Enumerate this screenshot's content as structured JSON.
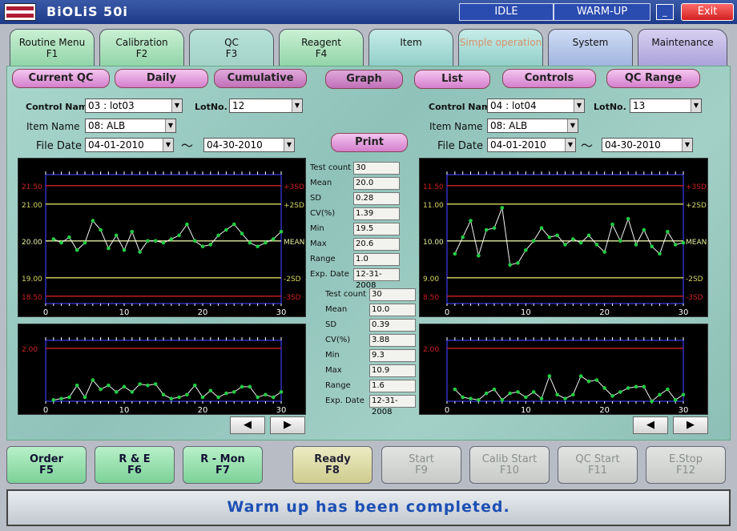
{
  "app": {
    "title": "BiOLiS  50i",
    "status_idle": "IDLE",
    "status_warmup": "WARM-UP",
    "minimize": "_",
    "exit": "Exit"
  },
  "tabs": [
    {
      "label": "Routine Menu",
      "key": "F1"
    },
    {
      "label": "Calibration",
      "key": "F2"
    },
    {
      "label": "QC",
      "key": "F3"
    },
    {
      "label": "Reagent",
      "key": "F4"
    },
    {
      "label": "Item",
      "key": ""
    },
    {
      "label": "Simple operation",
      "key": ""
    },
    {
      "label": "System",
      "key": ""
    },
    {
      "label": "Maintenance",
      "key": ""
    }
  ],
  "subnav": {
    "current_qc": "Current QC",
    "daily": "Daily",
    "cumulative": "Cumulative",
    "graph": "Graph",
    "list": "List",
    "controls": "Controls",
    "qc_range": "QC Range",
    "print": "Print"
  },
  "left": {
    "control_name_label": "Control Name",
    "control_name": "03 : lot03",
    "lotno_label": "LotNo.",
    "lotno": "12",
    "item_name_label": "Item Name",
    "item_name": "08: ALB",
    "file_date_label": "File Date",
    "date_from": "04-01-2010",
    "tilde": "〜",
    "date_to": "04-30-2010",
    "stats_labels": [
      "Test count",
      "Mean",
      "SD",
      "CV(%)",
      "Min",
      "Max",
      "Range",
      "Exp. Date"
    ],
    "stats_values": [
      "30",
      "20.0",
      "0.28",
      "1.39",
      "19.5",
      "20.6",
      "1.0",
      "12-31-2008"
    ]
  },
  "right": {
    "control_name_label": "Control Name",
    "control_name": "04 : lot04",
    "lotno_label": "LotNo.",
    "lotno": "13",
    "item_name_label": "Item Name",
    "item_name": "08: ALB",
    "file_date_label": "File Date",
    "date_from": "04-01-2010",
    "tilde": "〜",
    "date_to": "04-30-2010",
    "stats_labels": [
      "Test count",
      "Mean",
      "SD",
      "CV(%)",
      "Min",
      "Max",
      "Range",
      "Exp. Date"
    ],
    "stats_values": [
      "30",
      "10.0",
      "0.39",
      "3.88",
      "9.3",
      "10.9",
      "1.6",
      "12-31-2008"
    ]
  },
  "chart_data": [
    {
      "type": "line",
      "name": "left-levey-jennings",
      "ylim": [
        18.3,
        21.8
      ],
      "yticks": [
        "21.50",
        "21.00",
        "20.00",
        "19.00",
        "18.50"
      ],
      "ytick_values": [
        21.5,
        21.0,
        20.0,
        19.0,
        18.5
      ],
      "sd_labels": [
        "+3SD",
        "+2SD",
        "MEAN",
        "-2SD",
        "-3SD"
      ],
      "xticks": [
        "0",
        "10",
        "20",
        "30"
      ],
      "x": [
        1,
        2,
        3,
        4,
        5,
        6,
        7,
        8,
        9,
        10,
        11,
        12,
        13,
        14,
        15,
        16,
        17,
        18,
        19,
        20,
        21,
        22,
        23,
        24,
        25,
        26,
        27,
        28,
        29,
        30
      ],
      "values": [
        20.05,
        19.95,
        20.1,
        19.75,
        19.95,
        20.55,
        20.3,
        19.8,
        20.15,
        19.75,
        20.25,
        19.7,
        20.0,
        20.0,
        19.95,
        20.05,
        20.15,
        20.45,
        20.0,
        19.85,
        19.9,
        20.15,
        20.3,
        20.45,
        20.2,
        19.95,
        19.85,
        19.95,
        20.05,
        20.25
      ]
    },
    {
      "type": "line",
      "name": "left-range-chart",
      "ylim": [
        0,
        2.3
      ],
      "yticks": [
        "2.00"
      ],
      "ytick_values": [
        2.0
      ],
      "xticks": [
        "0",
        "10",
        "20",
        "30"
      ],
      "x": [
        1,
        2,
        3,
        4,
        5,
        6,
        7,
        8,
        9,
        10,
        11,
        12,
        13,
        14,
        15,
        16,
        17,
        18,
        19,
        20,
        21,
        22,
        23,
        24,
        25,
        26,
        27,
        28,
        29,
        30
      ],
      "values": [
        0.05,
        0.1,
        0.15,
        0.6,
        0.15,
        0.8,
        0.45,
        0.6,
        0.35,
        0.55,
        0.35,
        0.65,
        0.6,
        0.65,
        0.25,
        0.1,
        0.15,
        0.25,
        0.6,
        0.15,
        0.4,
        0.15,
        0.3,
        0.35,
        0.55,
        0.55,
        0.15,
        0.25,
        0.15,
        0.35
      ]
    },
    {
      "type": "line",
      "name": "right-levey-jennings",
      "ylim": [
        8.3,
        11.8
      ],
      "yticks": [
        "11.50",
        "11.00",
        "10.00",
        "9.00",
        "8.50"
      ],
      "ytick_values": [
        11.5,
        11.0,
        10.0,
        9.0,
        8.5
      ],
      "sd_labels": [
        "+3SD",
        "+2SD",
        "MEAN",
        "-2SD",
        "-3SD"
      ],
      "xticks": [
        "0",
        "10",
        "20",
        "30"
      ],
      "x": [
        1,
        2,
        3,
        4,
        5,
        6,
        7,
        8,
        9,
        10,
        11,
        12,
        13,
        14,
        15,
        16,
        17,
        18,
        19,
        20,
        21,
        22,
        23,
        24,
        25,
        26,
        27,
        28,
        29,
        30
      ],
      "values": [
        9.65,
        10.1,
        10.55,
        9.6,
        10.3,
        10.35,
        10.9,
        9.35,
        9.4,
        9.75,
        10.0,
        10.35,
        10.1,
        10.15,
        9.9,
        10.05,
        9.95,
        10.15,
        9.9,
        9.7,
        10.45,
        10.0,
        10.6,
        9.9,
        10.3,
        9.85,
        9.65,
        10.25,
        9.9,
        9.95
      ]
    },
    {
      "type": "line",
      "name": "right-range-chart",
      "ylim": [
        0,
        2.3
      ],
      "yticks": [
        "2.00"
      ],
      "ytick_values": [
        2.0
      ],
      "xticks": [
        "0",
        "10",
        "20",
        "30"
      ],
      "x": [
        1,
        2,
        3,
        4,
        5,
        6,
        7,
        8,
        9,
        10,
        11,
        12,
        13,
        14,
        15,
        16,
        17,
        18,
        19,
        20,
        21,
        22,
        23,
        24,
        25,
        26,
        27,
        28,
        29,
        30
      ],
      "values": [
        0.45,
        0.15,
        0.1,
        0.05,
        0.3,
        0.45,
        0.05,
        0.3,
        0.35,
        0.15,
        0.35,
        0.1,
        0.95,
        0.25,
        0.1,
        0.25,
        0.95,
        0.75,
        0.8,
        0.5,
        0.2,
        0.35,
        0.5,
        0.55,
        0.55,
        0.0,
        0.25,
        0.45,
        0.05,
        0.25
      ]
    }
  ],
  "nav": {
    "prev": "◀",
    "next": "▶"
  },
  "fkeys": [
    {
      "label": "Order",
      "key": "F5"
    },
    {
      "label": "R & E",
      "key": "F6"
    },
    {
      "label": "R - Mon",
      "key": "F7"
    },
    {
      "label": "Ready",
      "key": "F8"
    },
    {
      "label": "Start",
      "key": "F9"
    },
    {
      "label": "Calib Start",
      "key": "F10"
    },
    {
      "label": "QC Start",
      "key": "F11"
    },
    {
      "label": "E.Stop",
      "key": "F12"
    }
  ],
  "message": "Warm up has been completed.",
  "colors": {
    "title_bar": "#1d3a88",
    "sd3": "#d02020",
    "sd2": "#d8d860",
    "mean": "#e8f0a0",
    "data": "#22cc44",
    "axis": "#3030c0",
    "message_text": "#1d4fb4"
  }
}
